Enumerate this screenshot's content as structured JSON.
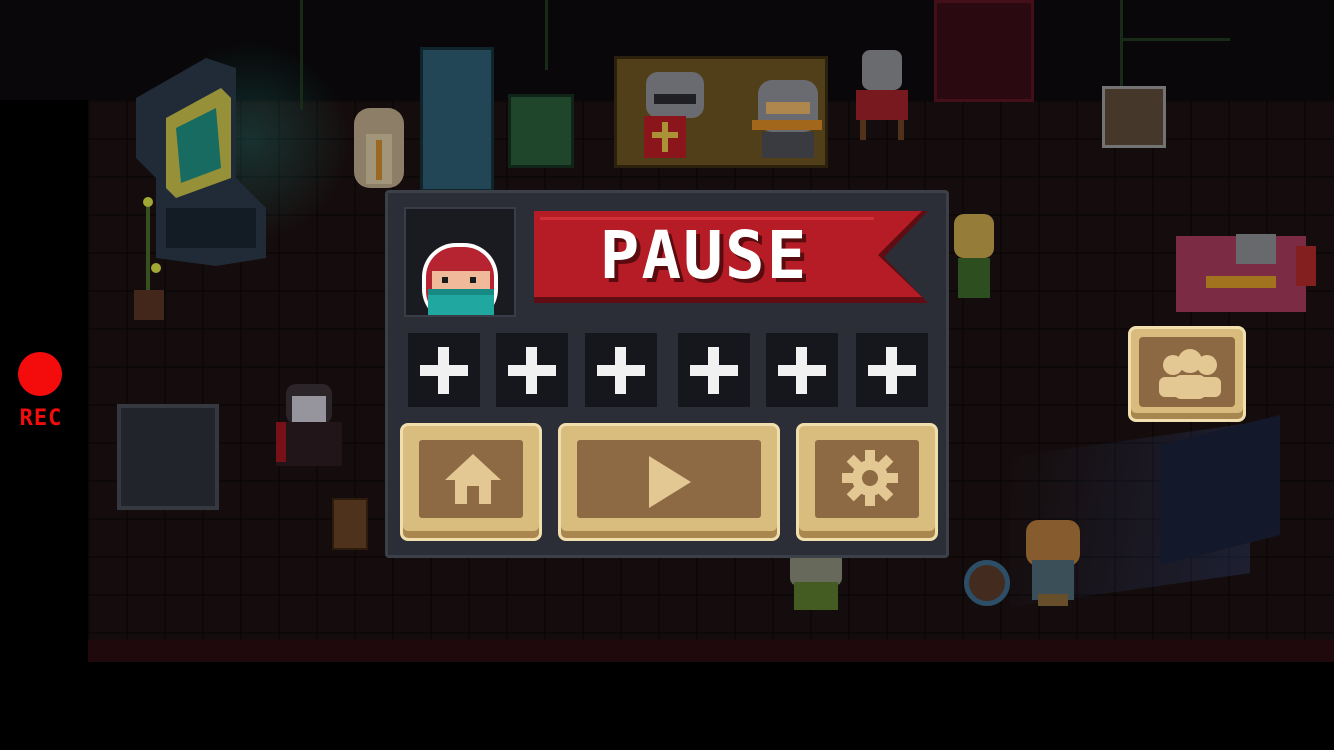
{
  "recording": {
    "label": "REC",
    "color": "#f40c0c"
  },
  "pause_menu": {
    "title": "PAUSE",
    "title_banner_color": "#b51c26",
    "character_portrait_icon": "ninja-hero-icon",
    "item_slots": [
      {
        "icon": "plus-icon",
        "state": "empty"
      },
      {
        "icon": "plus-icon",
        "state": "empty"
      },
      {
        "icon": "plus-icon",
        "state": "empty"
      },
      {
        "icon": "plus-icon",
        "state": "empty"
      },
      {
        "icon": "plus-icon",
        "state": "empty"
      },
      {
        "icon": "plus-icon",
        "state": "empty"
      }
    ],
    "buttons": [
      {
        "name": "home",
        "icon": "home-icon"
      },
      {
        "name": "resume",
        "icon": "play-icon"
      },
      {
        "name": "settings",
        "icon": "gear-icon"
      }
    ],
    "button_color": "#d9bd7f",
    "button_inner_color": "#8d6944",
    "button_glyph_color": "#e3c894"
  },
  "side_controls": {
    "friends_icon": "people-icon"
  }
}
